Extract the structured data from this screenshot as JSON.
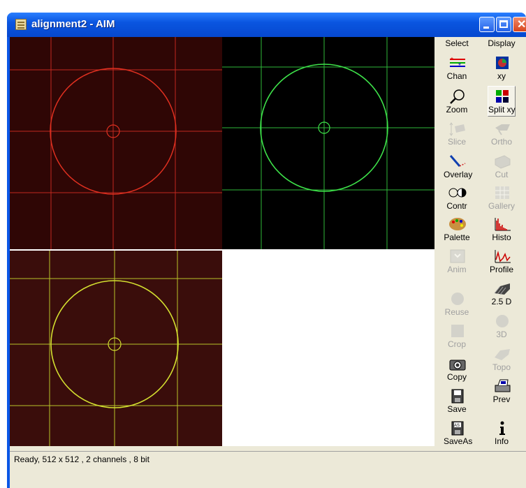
{
  "window": {
    "title": "alignment2 - AIM",
    "title_icon": "document-icon",
    "controls": [
      "minimize-icon",
      "maximize-icon",
      "close-icon"
    ]
  },
  "images": {
    "channel_1": {
      "color": "#e03020",
      "background": "#2f0605"
    },
    "channel_2": {
      "color": "#3ee34a",
      "background": "#000000"
    },
    "merged": {
      "color": "#d4e030",
      "background": "#3a0d0b"
    }
  },
  "toolbar": {
    "select_header": "Select",
    "display_header": "Display",
    "select_tools": [
      {
        "label": "Chan",
        "icon": "channels-icon",
        "enabled": true
      },
      {
        "label": "Zoom",
        "icon": "magnifier-icon",
        "enabled": true
      },
      {
        "label": "Slice",
        "icon": "slice-icon",
        "enabled": false
      },
      {
        "label": "Overlay",
        "icon": "pen-icon",
        "enabled": true
      },
      {
        "label": "Contr",
        "icon": "contrast-icon",
        "enabled": true
      },
      {
        "label": "Palette",
        "icon": "palette-icon",
        "enabled": true
      },
      {
        "label": "Anim",
        "icon": "animation-icon",
        "enabled": false
      },
      {
        "label": "Reuse",
        "icon": "reuse-icon",
        "enabled": false
      },
      {
        "label": "Crop",
        "icon": "crop-icon",
        "enabled": false
      },
      {
        "label": "Copy",
        "icon": "camera-icon",
        "enabled": true
      },
      {
        "label": "Save",
        "icon": "floppy-icon",
        "enabled": true
      },
      {
        "label": "SaveAs",
        "icon": "floppy-as-icon",
        "enabled": true
      }
    ],
    "display_tools": [
      {
        "label": "xy",
        "icon": "xy-icon",
        "enabled": true
      },
      {
        "label": "Split xy",
        "icon": "split-xy-icon",
        "enabled": true,
        "active": true
      },
      {
        "label": "Ortho",
        "icon": "ortho-icon",
        "enabled": false
      },
      {
        "label": "Cut",
        "icon": "cut-icon",
        "enabled": false
      },
      {
        "label": "Gallery",
        "icon": "gallery-icon",
        "enabled": false
      },
      {
        "label": "Histo",
        "icon": "histogram-icon",
        "enabled": true
      },
      {
        "label": "Profile",
        "icon": "profile-icon",
        "enabled": true
      },
      {
        "label": "2.5 D",
        "icon": "surface-2-5d-icon",
        "enabled": true
      },
      {
        "label": "3D",
        "icon": "3d-icon",
        "enabled": false
      },
      {
        "label": "Topo",
        "icon": "topo-icon",
        "enabled": false
      },
      {
        "label": "Prev",
        "icon": "print-preview-icon",
        "enabled": true
      },
      {
        "label": "Info",
        "icon": "info-icon",
        "enabled": true
      }
    ]
  },
  "status": {
    "text": "Ready, 512 x 512 , 2 channels , 8 bit"
  }
}
